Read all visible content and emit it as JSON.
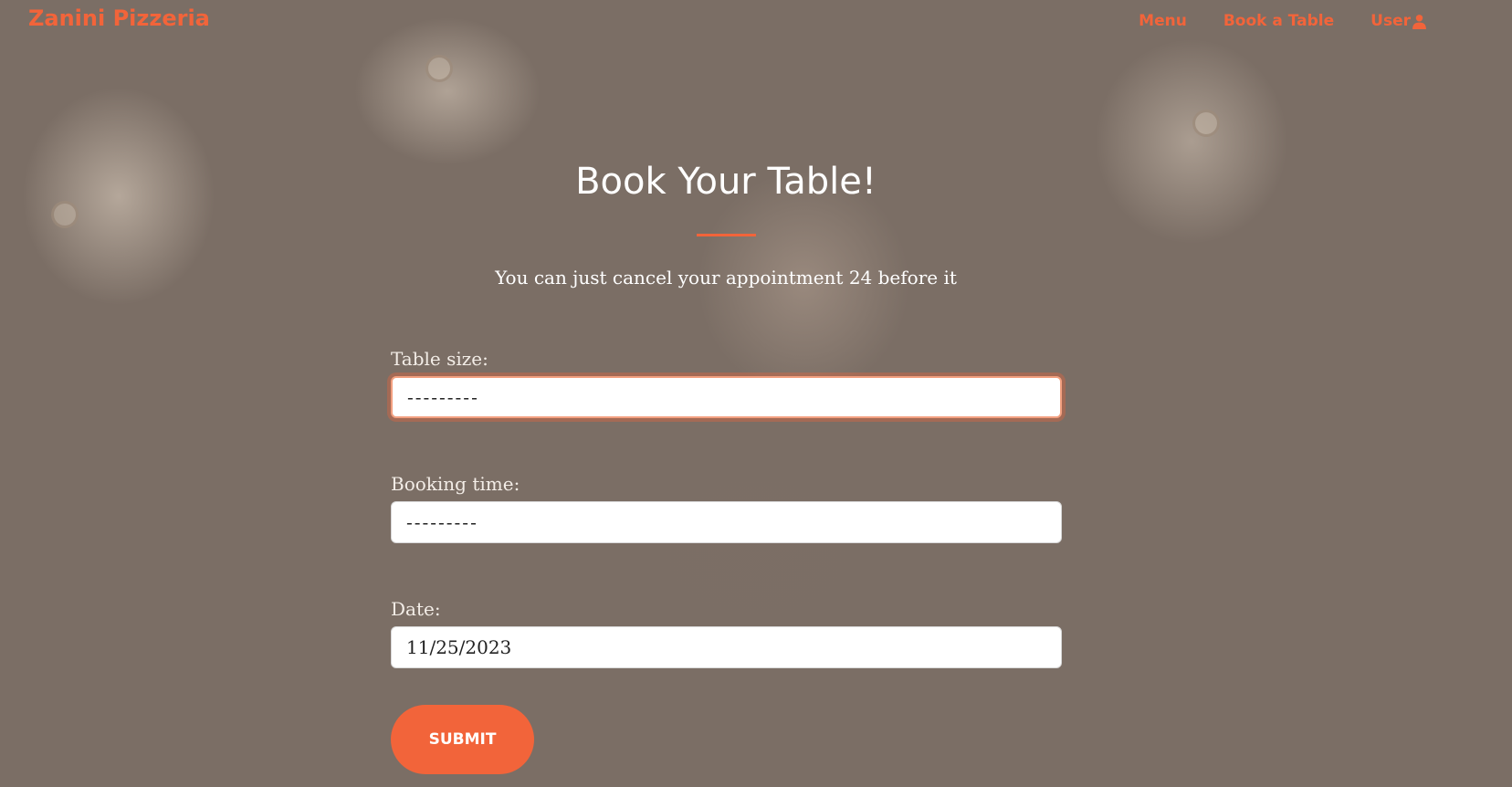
{
  "brand": {
    "name": "Zanini Pizzeria"
  },
  "nav": {
    "items": [
      {
        "label": "Menu"
      },
      {
        "label": "Book a Table"
      },
      {
        "label": "User",
        "icon": "user-icon"
      }
    ]
  },
  "header": {
    "title": "Book Your Table!",
    "subtitle": "You can just cancel your appointment 24 before it"
  },
  "form": {
    "table_size": {
      "label": "Table size:",
      "value": "---------"
    },
    "booking_time": {
      "label": "Booking time:",
      "value": "---------"
    },
    "date": {
      "label": "Date:",
      "value": "11/25/2023"
    },
    "submit_label": "SUBMIT"
  },
  "colors": {
    "accent": "#f2643a",
    "background": "#7b6e65",
    "text_light": "#ffffff",
    "input_background": "#ffffff"
  }
}
